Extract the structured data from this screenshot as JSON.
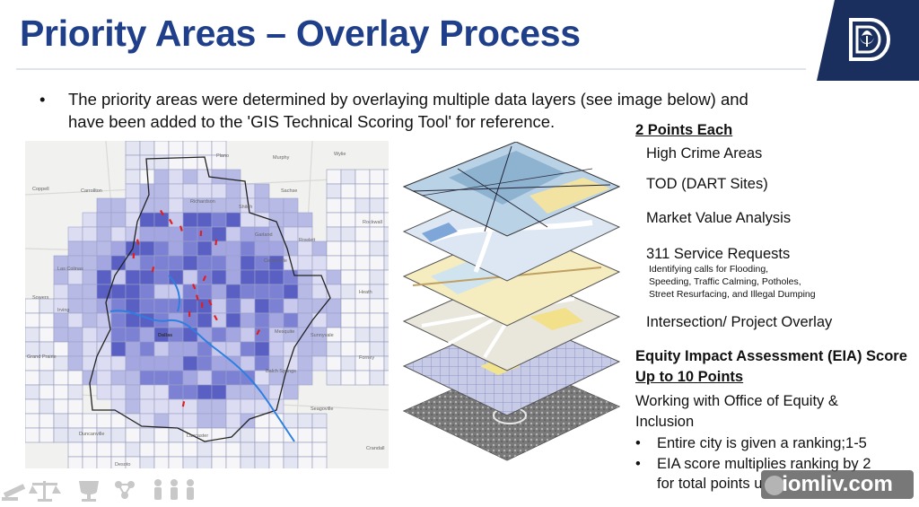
{
  "slide": {
    "title": "Priority Areas – Overlay Process",
    "bullet_marker": "•",
    "bullet_text": "The priority areas were determined by overlaying multiple data layers (see image below) and have been added to the 'GIS Technical Scoring Tool' for reference."
  },
  "map": {
    "labels": {
      "plano": "Plano",
      "murphy": "Murphy",
      "wylie": "Wylie",
      "coppell": "Coppell",
      "carrollton": "Carrollton",
      "richardson": "Richardson",
      "sachse": "Sachse",
      "garland": "Garland",
      "rowlett": "Rowlett",
      "rockwall": "Rockwall",
      "las_colinas": "Las Colinas",
      "irving": "Irving",
      "sowers": "Sowers",
      "dallas": "Dallas",
      "mesquite": "Mesquite",
      "sunnyvale": "Sunnyvale",
      "grand_prairie": "Grand Prairie",
      "forney": "Forney",
      "heath": "Heath",
      "balch_springs": "Balch Springs",
      "seagoville": "Seagoville",
      "duncanville": "Duncanville",
      "lancaster": "Lancaster",
      "desoto": "Desoto",
      "crandall": "Crandall",
      "centerville": "Centerville",
      "shiloh": "Shiloh"
    }
  },
  "right_panel": {
    "header_points": "2 Points Each",
    "items": [
      "High Crime Areas",
      "TOD (DART Sites)",
      "Market Value Analysis",
      "311 Service Requests"
    ],
    "service_note": [
      "Identifying calls for Flooding,",
      "Speeding, Traffic Calming, Potholes,",
      "Street Resurfacing, and Illegal Dumping"
    ],
    "intersection": "Intersection/ Project Overlay",
    "eia_title": "Equity Impact Assessment (EIA) Score",
    "eia_points": "Up to 10 Points",
    "working_line1": "Working with Office of Equity &",
    "working_line2": "Inclusion",
    "sub_bullets": [
      "Entire city is given a ranking;1-5",
      "EIA score multiplies ranking by 2",
      "for total points u"
    ]
  },
  "watermark": "iomliv.com",
  "colors": {
    "title_blue": "#1f3f8a",
    "logo_navy": "#1b2f5e",
    "map_purple": "#5a5fc4",
    "map_red": "#e02020",
    "map_blue_line": "#2d7fe0"
  }
}
